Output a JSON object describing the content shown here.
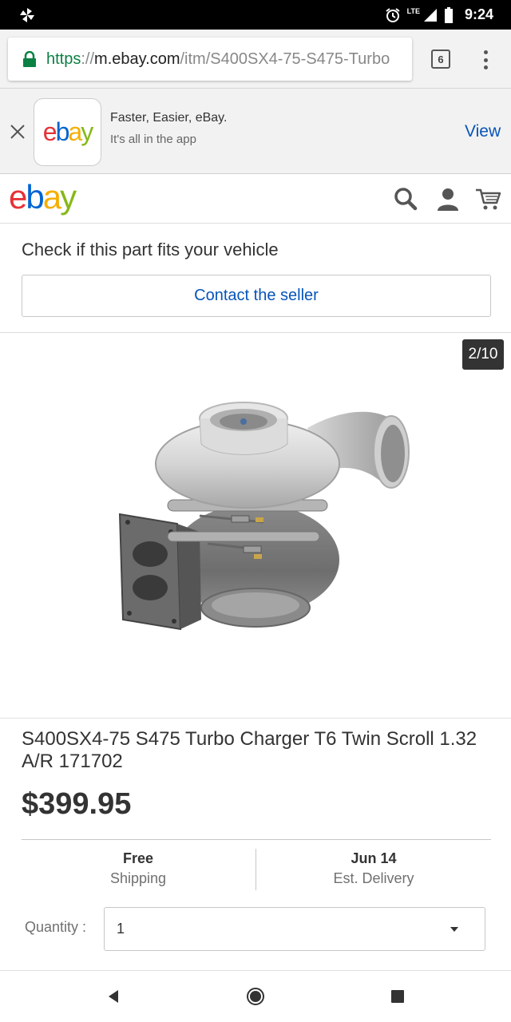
{
  "status_bar": {
    "time": "9:24",
    "network": "LTE"
  },
  "browser": {
    "url_scheme": "https",
    "url_sep": "://",
    "url_host": "m.ebay.com",
    "url_path": "/itm/S400SX4-75-S475-Turbo",
    "tab_count": "6"
  },
  "app_banner": {
    "logo": [
      "e",
      "b",
      "a",
      "y"
    ],
    "headline": "Faster, Easier, eBay.",
    "subline": "It's all in the app",
    "view_label": "View"
  },
  "header": {
    "logo": [
      "e",
      "b",
      "a",
      "y"
    ]
  },
  "fitment": {
    "title": "Check if this part fits your vehicle",
    "contact_label": "Contact the seller"
  },
  "gallery": {
    "counter": "2/10"
  },
  "product": {
    "title": "S400SX4-75 S475 Turbo Charger T6 Twin Scroll 1.32 A/R 171702",
    "price": "$399.95",
    "shipping_value": "Free",
    "shipping_label": "Shipping",
    "delivery_value": "Jun 14",
    "delivery_label": "Est. Delivery",
    "quantity_label": "Quantity :",
    "quantity_value": "1"
  },
  "colors": {
    "ebay_red": "#e53238",
    "ebay_blue": "#0064d2",
    "ebay_yellow": "#f5af02",
    "ebay_green": "#86b817",
    "link_blue": "#0654ba",
    "secure_green": "#0b8043"
  },
  "icons": [
    "pinwheel-icon",
    "alarm-icon",
    "signal-icon",
    "battery-icon",
    "lock-icon",
    "tabs-icon",
    "overflow-menu-icon",
    "close-icon",
    "search-icon",
    "user-icon",
    "cart-icon",
    "dropdown-caret-icon",
    "back-icon",
    "home-icon",
    "recents-icon"
  ]
}
